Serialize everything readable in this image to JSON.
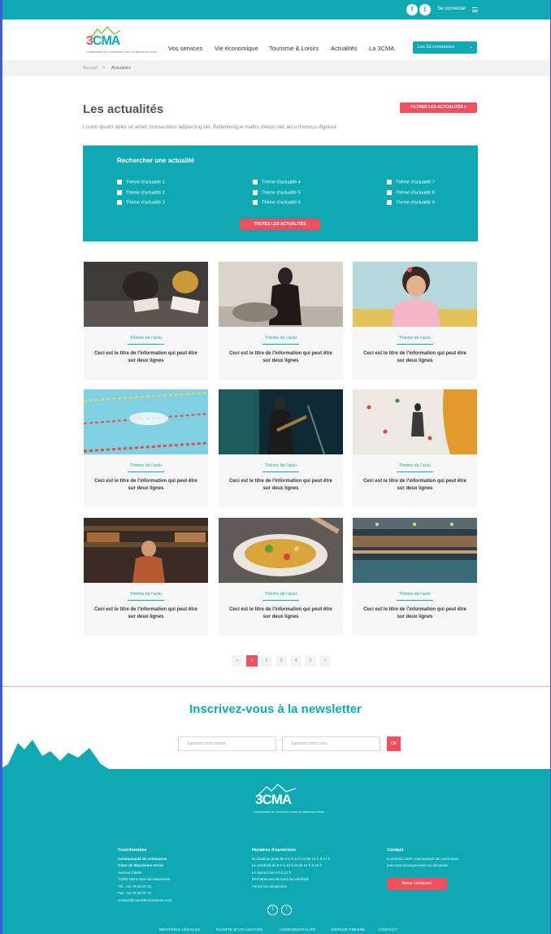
{
  "topbar": {
    "social_facebook": "f",
    "social_twitter": "t",
    "login_label": "Se connecter",
    "menu_icon": "hamburger-icon"
  },
  "header": {
    "logo_text": "3CMA",
    "logo_subtitle": "Communauté de Communes Cœur de Maurienne Arvan",
    "nav": [
      "Vos services",
      "Vie économique",
      "Tourisme & Loisirs",
      "Actualités",
      "La 3CMA"
    ],
    "cta_label": "Les 16 communes"
  },
  "breadcrumb": {
    "home": "Accueil",
    "separator": ">",
    "current": "Actualités"
  },
  "page": {
    "title": "Les actualités",
    "filter_label": "FILTRER LES ACTUALITÉS",
    "intro": "Lorem ipsum dolor sit amet, consectetur adipiscing elit. Pellentesque mattis metus nec arcu rhoncus dignissi."
  },
  "search": {
    "title": "Rechercher une actualité",
    "checkboxes": [
      [
        "Thème d'actualité 1",
        "Thème d'actualité 4",
        "Thème d'actualité 7"
      ],
      [
        "Thème d'actualité 2",
        "Thème d'actualité 5",
        "Thème d'actualité 8"
      ],
      [
        "Thème d'actualité 3",
        "Thème d'actualité 6",
        "Thème d'actualité 9"
      ]
    ],
    "all_label": "TOUTES LES ACTUALITÉS"
  },
  "cards": [
    {
      "theme": "Thème de l'actu",
      "title": "Ceci est le titre de l'information qui peut être sur deux lignes",
      "image": "students-reading"
    },
    {
      "theme": "Thème de l'actu",
      "title": "Ceci est le titre de l'information qui peut être sur deux lignes",
      "image": "woman-sitting"
    },
    {
      "theme": "Thème de l'actu",
      "title": "Ceci est le titre de l'information qui peut être sur deux lignes",
      "image": "child-portrait"
    },
    {
      "theme": "Thème de l'actu",
      "title": "Ceci est le titre de l'information qui peut être sur deux lignes",
      "image": "swimming-pool"
    },
    {
      "theme": "Thème de l'actu",
      "title": "Ceci est le titre de l'information qui peut être sur deux lignes",
      "image": "concert-guitarist"
    },
    {
      "theme": "Thème de l'actu",
      "title": "Ceci est le titre de l'information qui peut être sur deux lignes",
      "image": "climbing-wall"
    },
    {
      "theme": "Thème de l'actu",
      "title": "Ceci est le titre de l'information qui peut être sur deux lignes",
      "image": "shop-interior"
    },
    {
      "theme": "Thème de l'actu",
      "title": "Ceci est le titre de l'information qui peut être sur deux lignes",
      "image": "food-plate"
    },
    {
      "theme": "Thème de l'actu",
      "title": "Ceci est le titre de l'information qui peut être sur deux lignes",
      "image": "bar-interior"
    }
  ],
  "pagination": {
    "prev": "<",
    "pages": [
      "1",
      "2",
      "3",
      "4",
      "5"
    ],
    "current_page": 1,
    "next": ">"
  },
  "newsletter": {
    "title": "Inscrivez-vous à la newsletter",
    "email_placeholder": "Saisissez votre email",
    "name_placeholder": "Saisissez votre nom",
    "ok_label": "OK"
  },
  "footer": {
    "logo_text": "3CMA",
    "logo_subtitle": "Communauté de Communes Cœur de Maurienne Arvan",
    "col1": {
      "title": "Coordonnées",
      "lines": [
        "Communauté de communes",
        "Cœur de Maurienne Arvan",
        "Avenue d'Italie",
        "73300 Saint-Jean-de-Maurienne",
        "Tél. : 04 79 83 07 31",
        "Fax : 04 79 83 07 31",
        "contact@coeurdemaurienne.com"
      ]
    },
    "col2": {
      "title": "Horaires d'ouverture",
      "lines": [
        "Du lundi au jeudi de 8 h à 12 h et de 14 h à 17 h",
        "Le vendredi de 8 h à 12 h et de 14 h à 16 h",
        "Le samedi de 9 h à 12 h",
        "Permanences du lundi au vendredi",
        "Fermé les dimanches"
      ]
    },
    "col3": {
      "title": "Contact",
      "lines": [
        "Contactez votre communauté de communes",
        "pour tout renseignement ou demande"
      ],
      "button": "Nous contacter"
    },
    "social": [
      "f",
      "t"
    ],
    "links": [
      "MENTIONS LÉGALES",
      "CHARTE D'UTILISATION",
      "CONFIDENTIALITÉ",
      "ESPACE PRESSE",
      "CONTACT"
    ]
  },
  "colors": {
    "teal": "#0fa9b3",
    "coral": "#ef4f5f",
    "text": "#3b3b3b"
  }
}
